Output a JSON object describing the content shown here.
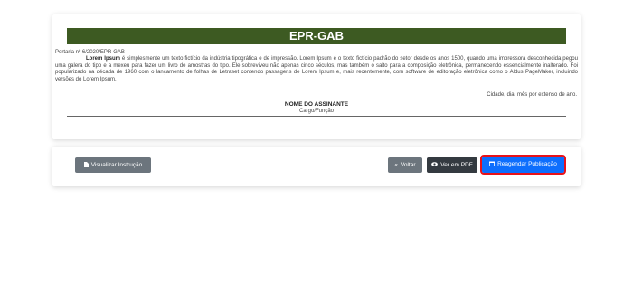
{
  "document": {
    "header": "EPR-GAB",
    "reference": "Portaria nº 6/2020/EPR-GAB",
    "body_bold": "Lorem Ipsum",
    "body_text": " é simplesmente um texto fictício da indústria tipográfica e de impressão. Lorem Ipsum é o texto fictício padrão do setor desde os anos 1500, quando uma impressora desconhecida pegou uma galera do tipo e a mexeu para fazer um livro de amostras do tipo. Ele sobreviveu não apenas cinco séculos, mas também o salto para a composição eletrônica, permanecendo essencialmente inalterado. Foi popularizado na década de 1960 com o lançamento de folhas de Letraset contendo passagens de Lorem Ipsum e, mais recentemente, com software de editoração eletrônica como o Aldus PageMaker, incluindo versões do Lorem Ipsum.",
    "place_date": "Cidade, dia, mês por extenso de ano.",
    "signer_name": "NOME DO ASSINANTE",
    "signer_role": "Cargo/Função"
  },
  "actions": {
    "view_instruction": {
      "label": "Visualizar Instrução",
      "icon": "file-icon"
    },
    "back": {
      "label": "Voltar",
      "icon": "double-chevron-left-icon"
    },
    "view_pdf": {
      "label": "Ver em PDF",
      "icon": "eye-icon"
    },
    "reschedule": {
      "label": "Reagendar Publicação",
      "icon": "calendar-icon"
    }
  },
  "colors": {
    "header_bg": "#3d5a22",
    "btn_gray": "#6c757d",
    "btn_dark": "#343a40",
    "btn_blue": "#0d6efd",
    "highlight": "#e8121a"
  }
}
